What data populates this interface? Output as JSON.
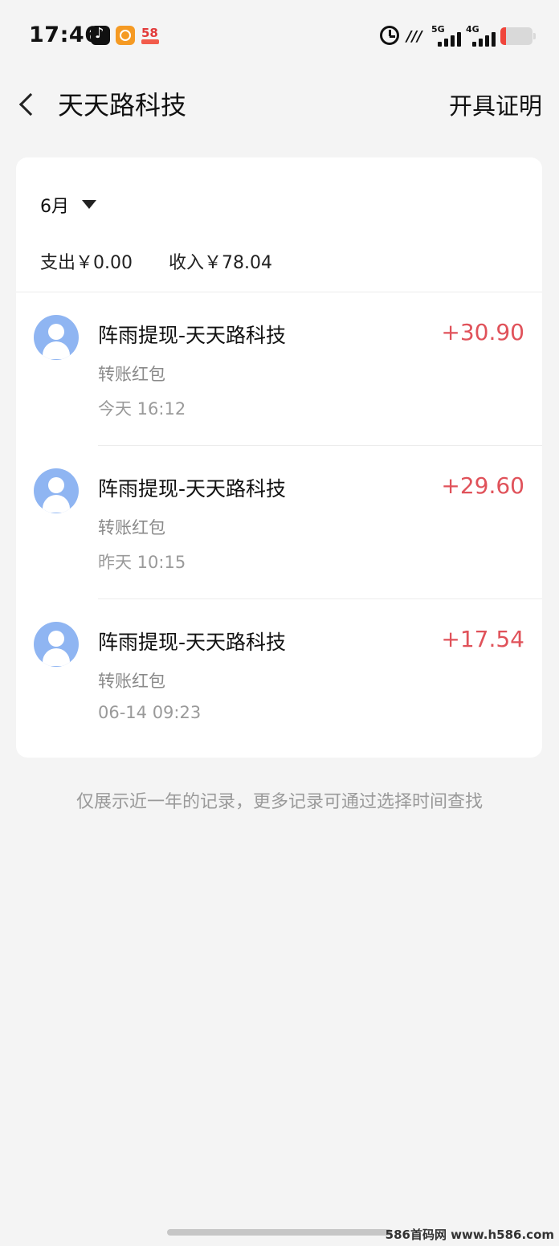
{
  "status_bar": {
    "time": "17:46",
    "network_5g": "5G",
    "network_4g": "4G",
    "battery_level": 0.15,
    "battery_color": "#f0453b"
  },
  "nav": {
    "title": "天天路科技",
    "action": "开具证明"
  },
  "filter": {
    "month": "6月"
  },
  "summary": {
    "expense": "支出￥0.00",
    "income": "收入￥78.04"
  },
  "transactions": [
    {
      "name": "阵雨提现-天天路科技",
      "type": "转账红包",
      "time": "今天 16:12",
      "amount": "+30.90"
    },
    {
      "name": "阵雨提现-天天路科技",
      "type": "转账红包",
      "time": "昨天 10:15",
      "amount": "+29.60"
    },
    {
      "name": "阵雨提现-天天路科技",
      "type": "转账红包",
      "time": "06-14 09:23",
      "amount": "+17.54"
    }
  ],
  "footer": {
    "note": "仅展示近一年的记录，更多记录可通过选择时间查找",
    "watermark": "586首码网 www.h586.com"
  },
  "colors": {
    "amount_positive": "#e0525a",
    "avatar": "#8fb5f2",
    "background": "#f4f4f4"
  }
}
